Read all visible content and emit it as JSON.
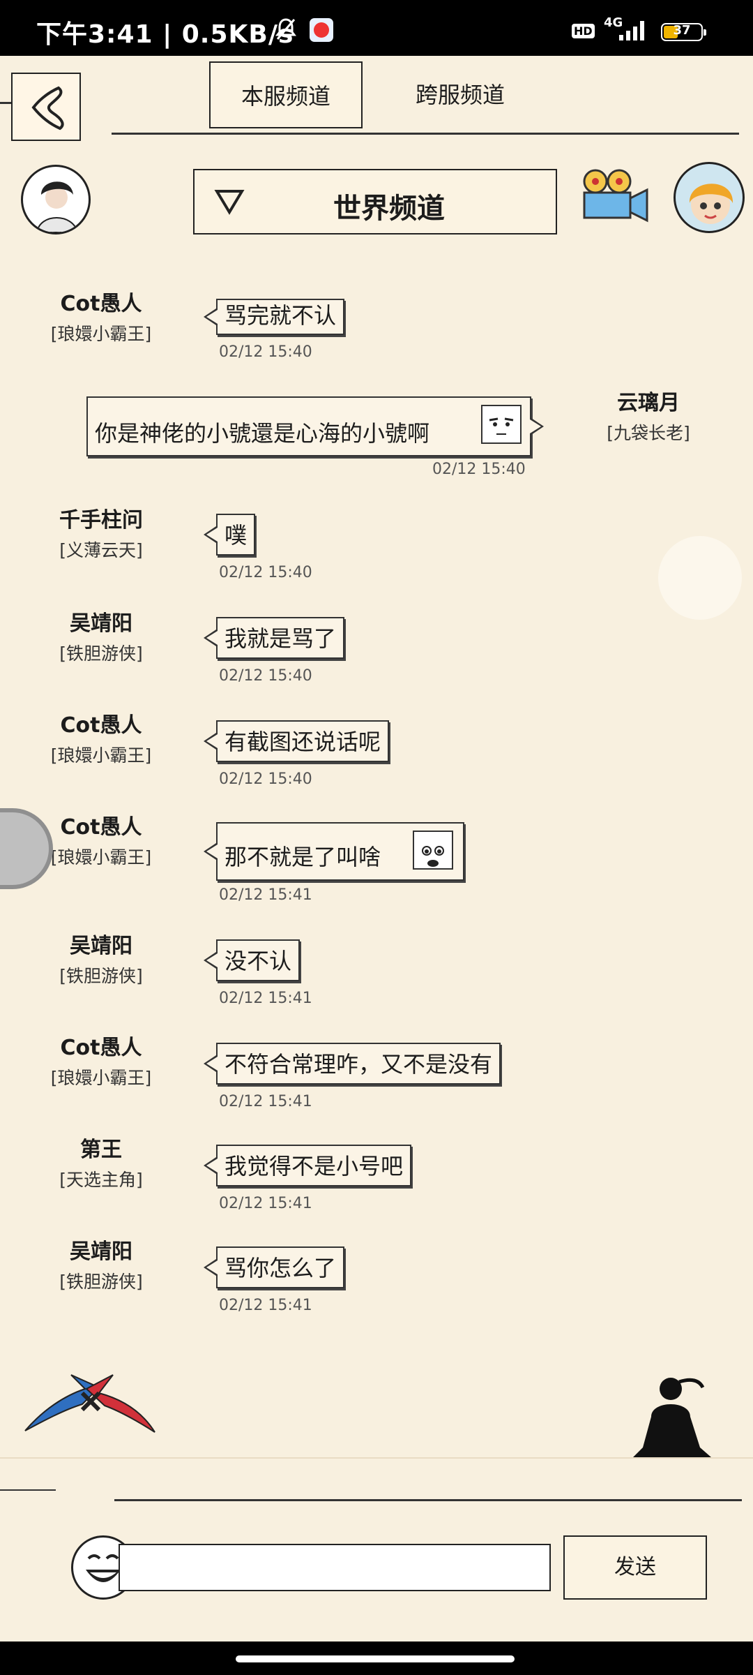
{
  "status_bar": {
    "time_speed": "下午3:41 | 0.5KB/s",
    "hd": "HD",
    "network": "4G",
    "battery": "37"
  },
  "header": {
    "tabs": [
      {
        "label": "本服频道",
        "active": true
      },
      {
        "label": "跨服频道",
        "active": false
      }
    ],
    "channel": "世界频道"
  },
  "messages": [
    {
      "name": "Cot愚人",
      "title": "[琅嬛小霸王]",
      "text": "骂完就不认",
      "time": "02/12 15:40"
    },
    {
      "name": "云璃月",
      "title": "[九袋长老]",
      "text": "你是神佬的小號還是心海的小號啊",
      "time": "02/12 15:40",
      "side": "right"
    },
    {
      "name": "千手柱问",
      "title": "[义薄云天]",
      "text": "噗",
      "time": "02/12 15:40"
    },
    {
      "name": "吴靖阳",
      "title": "[铁胆游侠]",
      "text": "我就是骂了",
      "time": "02/12 15:40"
    },
    {
      "name": "Cot愚人",
      "title": "[琅嬛小霸王]",
      "text": "有截图还说话呢",
      "time": "02/12 15:40"
    },
    {
      "name": "Cot愚人",
      "title": "[琅嬛小霸王]",
      "text": "那不就是了叫啥",
      "time": "02/12 15:41"
    },
    {
      "name": "吴靖阳",
      "title": "[铁胆游侠]",
      "text": "没不认",
      "time": "02/12 15:41"
    },
    {
      "name": "Cot愚人",
      "title": "[琅嬛小霸王]",
      "text": "不符合常理咋，又不是没有",
      "time": "02/12 15:41"
    },
    {
      "name": "第王",
      "title": "[天选主角]",
      "text": "我觉得不是小号吧",
      "time": "02/12 15:41"
    },
    {
      "name": "吴靖阳",
      "title": "[铁胆游侠]",
      "text": "骂你怎么了",
      "time": "02/12 15:41"
    }
  ],
  "input": {
    "value": "",
    "send_label": "发送"
  },
  "icons": {
    "back": "back-arrow-icon",
    "channel_dropdown": "triangle-down-icon",
    "camera": "movie-camera-icon",
    "emoji": "laughing-face-icon"
  },
  "colors": {
    "background": "#f8f0df",
    "ink": "#1c1c1c",
    "status_bar": "#000000"
  }
}
